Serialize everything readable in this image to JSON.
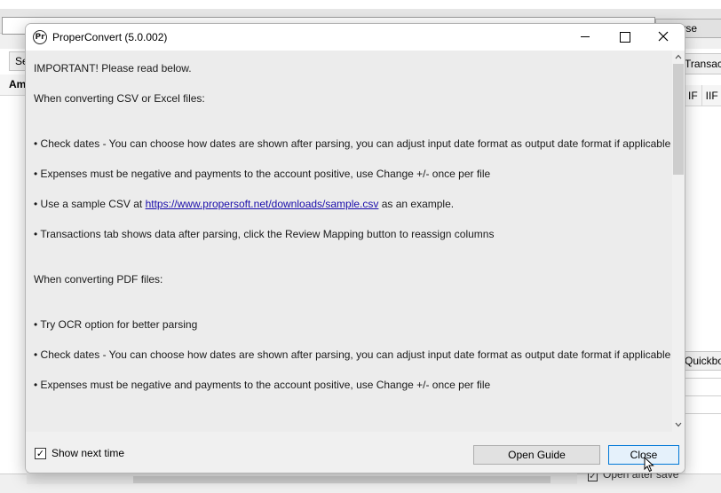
{
  "background": {
    "browse_label": "Browse",
    "tab_left_label": "Se",
    "col_left_label": "Am",
    "tab_right_label": "Transactions",
    "hdr_right": [
      "IF",
      "IIF"
    ],
    "quickbooks_label": "Quickbooks",
    "open_after_save_label": "Open after save"
  },
  "dialog": {
    "title": "ProperConvert (5.0.002)",
    "icon_text": "Pr",
    "content": {
      "important": "IMPORTANT! Please read below.",
      "csv_heading": "When converting CSV or Excel files:",
      "csv_bullet_1": "•  Check dates - You can choose how dates are shown after parsing, you can adjust input date format as output date format if applicable",
      "csv_bullet_2": "•  Expenses must be negative and payments to the account positive, use Change +/- once per file",
      "csv_bullet_3_prefix": "•  Use a sample CSV at ",
      "csv_bullet_3_link": "https://www.propersoft.net/downloads/sample.csv",
      "csv_bullet_3_suffix": " as an example.",
      "csv_bullet_4": "•  Transactions tab shows data after parsing, click the Review Mapping button to reassign columns",
      "pdf_heading": "When converting PDF files:",
      "pdf_bullet_1": "•  Try OCR option for better parsing",
      "pdf_bullet_2": "•  Check dates - You can choose how dates are shown after parsing, you can adjust input date format as output date format if applicable",
      "pdf_bullet_3": "•  Expenses must be negative and payments to the account positive, use Change +/- once per file"
    },
    "footer": {
      "show_next_time_label": "Show next time",
      "show_next_time_checked": true,
      "open_guide_label": "Open Guide",
      "close_label": "Close"
    }
  }
}
